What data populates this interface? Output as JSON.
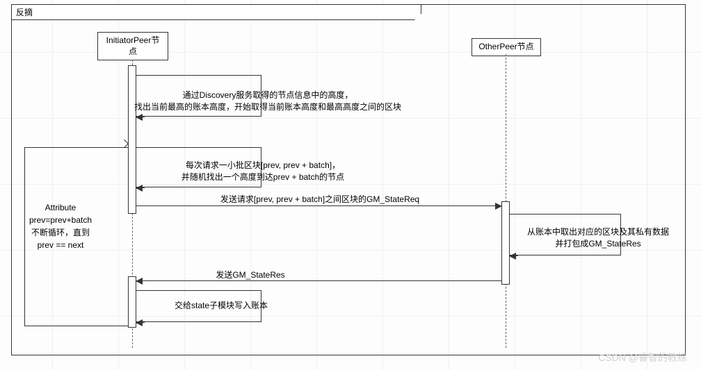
{
  "frame": {
    "title": "反摘"
  },
  "lifelines": {
    "initiator": "InitiatorPeer节\n点",
    "other": "OtherPeer节点"
  },
  "messages": {
    "m1": "通过Discovery服务取得的节点信息中的高度，\n找出当前最高的账本高度，开始取得当前账本高度和最高高度之间的区块",
    "m2": "每次请求一小批区块[prev, prev + batch]，\n并随机找出一个高度到达prev + batch的节点",
    "m3": "发送请求[prev, prev + batch]之间区块的GM_StateReq",
    "m4": "从账本中取出对应的区块及其私有数据\n并打包成GM_StateRes",
    "m5": "发送GM_StateRes",
    "m6": "交给state子模块写入账本"
  },
  "note": "Attribute\nprev=prev+batch\n不断循环，直到\nprev == next",
  "watermark": "CSDN @睿智的教练",
  "chart_data": {
    "type": "sequence-diagram",
    "frame_title": "反摘",
    "participants": [
      {
        "id": "InitiatorPeer",
        "label": "InitiatorPeer节点"
      },
      {
        "id": "OtherPeer",
        "label": "OtherPeer节点"
      }
    ],
    "interactions": [
      {
        "from": "InitiatorPeer",
        "to": "InitiatorPeer",
        "kind": "self",
        "text": "通过Discovery服务取得的节点信息中的高度，找出当前最高的账本高度，开始取得当前账本高度和最高高度之间的区块"
      },
      {
        "from": "InitiatorPeer",
        "to": "InitiatorPeer",
        "kind": "self",
        "text": "每次请求一小批区块[prev, prev + batch]，并随机找出一个高度到达prev + batch的节点"
      },
      {
        "from": "InitiatorPeer",
        "to": "OtherPeer",
        "kind": "sync",
        "text": "发送请求[prev, prev + batch]之间区块的GM_StateReq"
      },
      {
        "from": "OtherPeer",
        "to": "OtherPeer",
        "kind": "self",
        "text": "从账本中取出对应的区块及其私有数据并打包成GM_StateRes"
      },
      {
        "from": "OtherPeer",
        "to": "InitiatorPeer",
        "kind": "sync",
        "text": "发送GM_StateRes"
      },
      {
        "from": "InitiatorPeer",
        "to": "InitiatorPeer",
        "kind": "self",
        "text": "交给state子模块写入账本"
      }
    ],
    "loop_note": "Attribute prev=prev+batch 不断循环，直到 prev == next"
  }
}
